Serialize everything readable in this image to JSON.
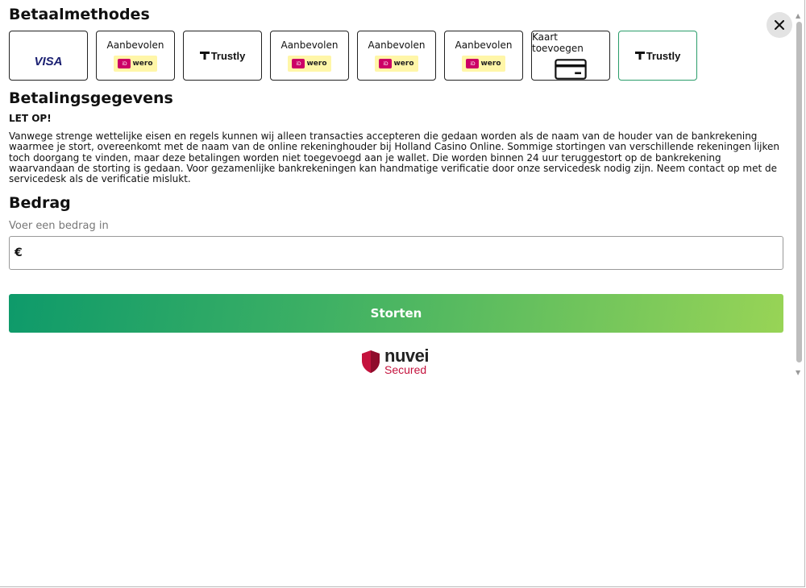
{
  "headings": {
    "methods": "Betaalmethodes",
    "details": "Betalingsgegevens",
    "amount": "Bedrag"
  },
  "close_icon": "close-icon",
  "payment_methods": [
    {
      "label": "",
      "logo": "VISA",
      "icon": "visa-logo",
      "selected": false
    },
    {
      "label": "Aanbevolen",
      "logo": "wero",
      "icon": "ideal-wero-logo",
      "selected": false
    },
    {
      "label": "",
      "logo": "Trustly",
      "icon": "trustly-logo",
      "selected": false
    },
    {
      "label": "Aanbevolen",
      "logo": "wero",
      "icon": "ideal-wero-logo",
      "selected": false
    },
    {
      "label": "Aanbevolen",
      "logo": "wero",
      "icon": "ideal-wero-logo",
      "selected": false
    },
    {
      "label": "Aanbevolen",
      "logo": "wero",
      "icon": "ideal-wero-logo",
      "selected": false
    },
    {
      "label": "Kaart toevoegen",
      "logo": "",
      "icon": "credit-card-icon",
      "selected": false
    },
    {
      "label": "",
      "logo": "Trustly",
      "icon": "trustly-logo",
      "selected": true
    }
  ],
  "notice": {
    "title": "LET OP!",
    "text": "Vanwege strenge wettelijke eisen en regels kunnen wij alleen transacties accepteren die gedaan worden als de naam van de houder van de bankrekening waarmee je stort, overeenkomt met de naam van de online rekeninghouder bij Holland Casino Online. Sommige stortingen van verschillende rekeningen lijken toch doorgang te vinden, maar deze betalingen worden niet toegevoegd aan je wallet. Die worden binnen 24 uur teruggestort op de bankrekening waarvandaan de storting is gedaan. Voor gezamenlijke bankrekeningen kan handmatige verificatie door onze servicedesk nodig zijn. Neem contact op met de servicedesk als de verificatie mislukt."
  },
  "amount": {
    "label": "Voer een bedrag in",
    "currency": "€",
    "value": ""
  },
  "submit_label": "Storten",
  "secured": {
    "brand": "nuvei",
    "tagline": "Secured"
  },
  "colors": {
    "selected_border": "#2a9d6a",
    "button_gradient_start": "#0e9a6a",
    "button_gradient_end": "#98d456",
    "secured_red": "#c4123d"
  }
}
